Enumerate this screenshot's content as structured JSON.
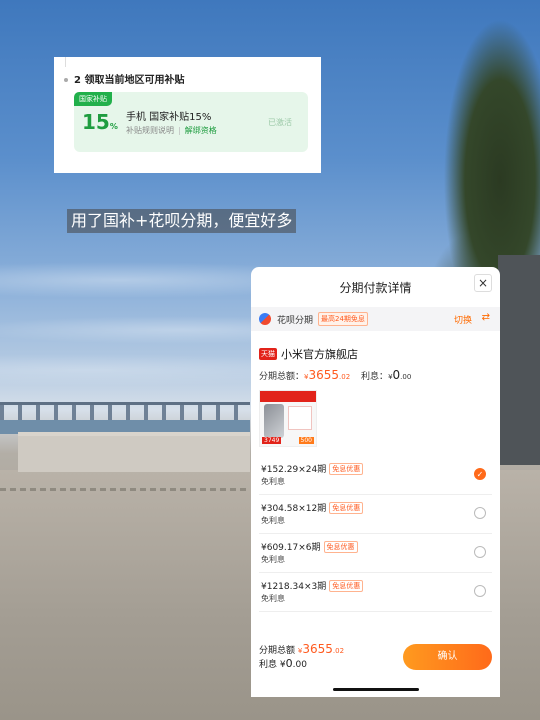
{
  "caption": "用了国补+花呗分期，便宜好多",
  "subsidy": {
    "step_title": "2 领取当前地区可用补贴",
    "tag": "国家补贴",
    "percent": "15",
    "percent_sign": "%",
    "title": "手机 国家补贴15%",
    "rules_link": "补贴规则说明",
    "unbind_link": "解绑资格",
    "status": "已激活"
  },
  "sheet": {
    "title": "分期付款详情",
    "close_glyph": "×",
    "payment_method": "花呗分期",
    "payment_badge": "最高24期免息",
    "switch_label": "切换",
    "switch_glyph": "⇄",
    "store_badge": "天猫",
    "store_name": "小米官方旗舰店",
    "total_label": "分期总额：",
    "currency": "¥",
    "total_int": "3655",
    "total_dec": ".02",
    "interest_label": "利息：",
    "interest_int": "0",
    "interest_dec": ".00",
    "product_price": "3749",
    "product_discount": "500",
    "plans": [
      {
        "amount": "¥152.29×24期",
        "badge": "免息优惠",
        "note": "免利息",
        "selected": true
      },
      {
        "amount": "¥304.58×12期",
        "badge": "免息优惠",
        "note": "免利息",
        "selected": false
      },
      {
        "amount": "¥609.17×6期",
        "badge": "免息优惠",
        "note": "免利息",
        "selected": false
      },
      {
        "amount": "¥1218.34×3期",
        "badge": "免息优惠",
        "note": "免利息",
        "selected": false
      }
    ],
    "check_glyph": "✓",
    "footer_total_label": "分期总额",
    "footer_interest_label": "利息",
    "confirm_label": "确认"
  },
  "colors": {
    "accent_orange": "#ff5a1f",
    "subsidy_green": "#1f9d40",
    "tmall_red": "#e2231a"
  },
  "icons": [
    "huabei-icon",
    "switch-icon",
    "close-icon",
    "check-icon",
    "tmall-badge"
  ]
}
